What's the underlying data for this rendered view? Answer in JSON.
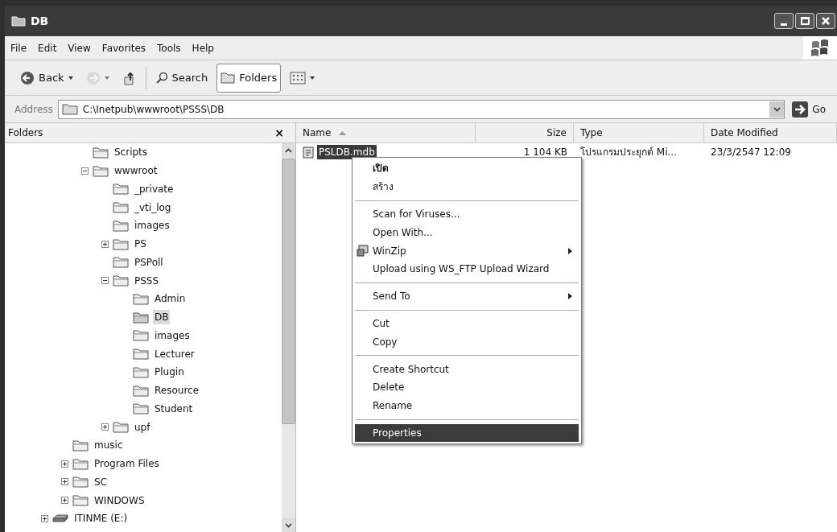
{
  "window": {
    "title": "DB"
  },
  "menu_bar": [
    "File",
    "Edit",
    "View",
    "Favorites",
    "Tools",
    "Help"
  ],
  "toolbar": [
    {
      "kind": "back",
      "label": "Back",
      "dropdown": true,
      "pressed": false,
      "disabled": false
    },
    {
      "kind": "forward",
      "dropdown": true,
      "pressed": false,
      "disabled": true
    },
    {
      "kind": "up",
      "dropdown": false,
      "pressed": false,
      "disabled": false
    },
    {
      "kind": "search",
      "label": "Search",
      "dropdown": false,
      "pressed": false,
      "disabled": false
    },
    {
      "kind": "folders",
      "label": "Folders",
      "dropdown": false,
      "pressed": true,
      "disabled": false
    },
    {
      "kind": "views",
      "dropdown": true,
      "pressed": false,
      "disabled": false
    }
  ],
  "address": {
    "label": "Address",
    "value": "C:\\Inetpub\\wwwroot\\PSSS\\DB",
    "go": "Go"
  },
  "folders_pane": {
    "title": "Folders",
    "close": "×"
  },
  "tree": [
    {
      "children": [
        {
          "children": [
            {
              "label": "Scripts",
              "kind": "folder",
              "selected": false
            },
            {
              "label": "wwwroot",
              "kind": "folder",
              "selected": false,
              "expanded": true,
              "children": [
                {
                  "label": "_private",
                  "kind": "folder",
                  "selected": false
                },
                {
                  "label": "_vti_log",
                  "kind": "folder",
                  "selected": false
                },
                {
                  "label": "images",
                  "kind": "folder",
                  "selected": false
                },
                {
                  "label": "PS",
                  "kind": "folder",
                  "selected": false,
                  "expanded": false
                },
                {
                  "label": "PSPoll",
                  "kind": "folder",
                  "selected": false
                },
                {
                  "label": "PSSS",
                  "kind": "folder",
                  "selected": false,
                  "expanded": true,
                  "children": [
                    {
                      "label": "Admin",
                      "kind": "folder",
                      "selected": false
                    },
                    {
                      "label": "DB",
                      "kind": "folder",
                      "selected": true
                    },
                    {
                      "label": "images",
                      "kind": "folder",
                      "selected": false
                    },
                    {
                      "label": "Lecturer",
                      "kind": "folder",
                      "selected": false
                    },
                    {
                      "label": "Plugin",
                      "kind": "folder",
                      "selected": false
                    },
                    {
                      "label": "Resource",
                      "kind": "folder",
                      "selected": false
                    },
                    {
                      "label": "Student",
                      "kind": "folder",
                      "selected": false
                    }
                  ]
                },
                {
                  "label": "upf",
                  "kind": "folder",
                  "selected": false,
                  "expanded": false
                }
              ]
            }
          ]
        },
        {
          "label": "music",
          "kind": "folder",
          "selected": false
        },
        {
          "label": "Program Files",
          "kind": "folder",
          "selected": false,
          "expanded": false
        },
        {
          "label": "SC",
          "kind": "folder",
          "selected": false,
          "expanded": false
        },
        {
          "label": "WINDOWS",
          "kind": "folder",
          "selected": false,
          "expanded": false
        }
      ]
    },
    {
      "label": "ITINME (E:)",
      "kind": "drive",
      "selected": false,
      "expanded": false
    }
  ],
  "file_list": {
    "columns": [
      {
        "label": "Name",
        "sorted": true
      },
      {
        "label": "Size",
        "sorted": false
      },
      {
        "label": "Type",
        "sorted": false
      },
      {
        "label": "Date Modified",
        "sorted": false
      }
    ],
    "rows": [
      {
        "name": "PSLDB.mdb",
        "size": "1 104 KB",
        "type": "โปรแกรมประยุกต์ Mi...",
        "date_modified": "23/3/2547 12:09",
        "selected": true
      }
    ]
  },
  "context_menu": [
    {
      "kind": "item",
      "label": "เปิด",
      "default": true,
      "submenu": false,
      "icon": false,
      "selected": false
    },
    {
      "kind": "item",
      "label": "สร้าง",
      "default": false,
      "submenu": false,
      "icon": false,
      "selected": false
    },
    {
      "kind": "separator"
    },
    {
      "kind": "item",
      "label": "Scan for Viruses...",
      "default": false,
      "submenu": false,
      "icon": false,
      "selected": false
    },
    {
      "kind": "item",
      "label": "Open With...",
      "default": false,
      "submenu": false,
      "icon": false,
      "selected": false
    },
    {
      "kind": "item",
      "label": "WinZip",
      "default": false,
      "submenu": true,
      "icon": true,
      "selected": false
    },
    {
      "kind": "item",
      "label": "Upload using WS_FTP Upload Wizard",
      "default": false,
      "submenu": false,
      "icon": false,
      "selected": false
    },
    {
      "kind": "separator"
    },
    {
      "kind": "item",
      "label": "Send To",
      "default": false,
      "submenu": true,
      "icon": false,
      "selected": false
    },
    {
      "kind": "separator"
    },
    {
      "kind": "item",
      "label": "Cut",
      "default": false,
      "submenu": false,
      "icon": false,
      "selected": false
    },
    {
      "kind": "item",
      "label": "Copy",
      "default": false,
      "submenu": false,
      "icon": false,
      "selected": false
    },
    {
      "kind": "separator"
    },
    {
      "kind": "item",
      "label": "Create Shortcut",
      "default": false,
      "submenu": false,
      "icon": false,
      "selected": false
    },
    {
      "kind": "item",
      "label": "Delete",
      "default": false,
      "submenu": false,
      "icon": false,
      "selected": false
    },
    {
      "kind": "item",
      "label": "Rename",
      "default": false,
      "submenu": false,
      "icon": false,
      "selected": false
    },
    {
      "kind": "separator"
    },
    {
      "kind": "item",
      "label": "Properties",
      "default": false,
      "submenu": false,
      "icon": false,
      "selected": true
    }
  ]
}
